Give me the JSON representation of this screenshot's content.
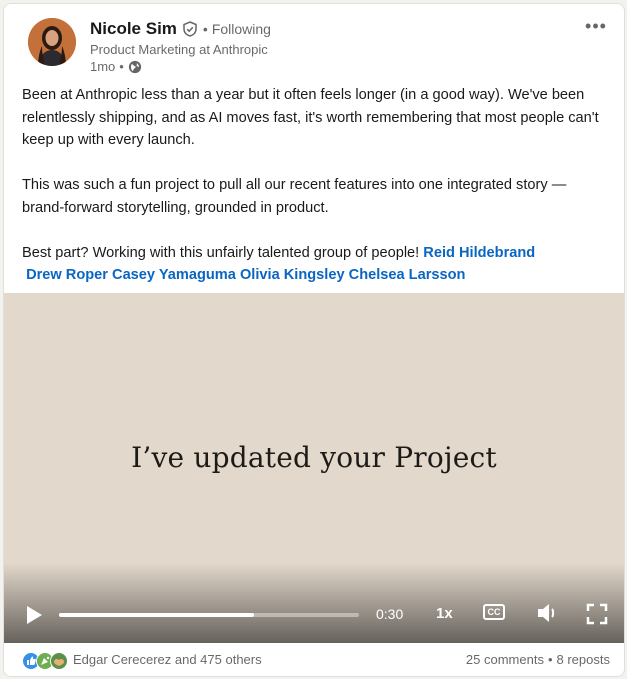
{
  "author": {
    "name": "Nicole Sim",
    "follow_status": "Following",
    "headline": "Product Marketing at Anthropic",
    "timestamp": "1mo"
  },
  "post": {
    "paragraph1": "Been at Anthropic less than a year but it often feels longer (in a good way). We've been relentlessly shipping, and as AI moves fast, it's worth remembering that most people can't keep up with every launch.",
    "paragraph2": "This was such a fun project to pull all our recent features into one integrated story — brand-forward storytelling, grounded in product.",
    "paragraph3_lead": "Best part? Working with this unfairly talented group of people!",
    "mentions": [
      "Reid Hildebrand",
      "Drew Roper",
      "Casey Yamaguma",
      "Olivia Kingsley",
      "Chelsea Larsson"
    ]
  },
  "video": {
    "caption": "I’ve updated your Project",
    "time": "0:30",
    "speed": "1x",
    "cc_label": "CC",
    "progress_fraction": 0.65
  },
  "footer": {
    "reactors": "Edgar Cerecerez and 475 others",
    "comments": "25 comments",
    "reposts": "8 reposts"
  },
  "icons": {
    "verified": "verified-shield-icon",
    "globe": "globe-icon",
    "more": "more-icon",
    "play": "play-icon",
    "volume": "volume-icon",
    "fullscreen": "fullscreen-icon"
  },
  "colors": {
    "link_blue": "#0a66c2",
    "video_bg": "#e2d8cb"
  }
}
